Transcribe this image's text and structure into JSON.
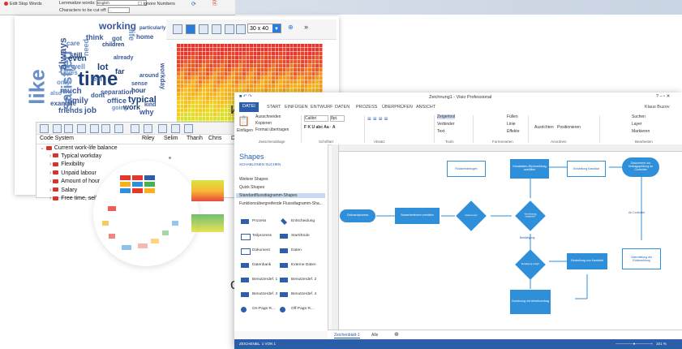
{
  "top_window": {
    "stop_words_label": "Edit Stop Words",
    "lemmatize_label": "Lemmatize words:",
    "language_value": "English",
    "chars_cut_label": "Characters to be cut off:",
    "chars_value": "...",
    "ignore_numbers_label": "Ignore Numbers"
  },
  "word_cloud": [
    {
      "w": "working",
      "c": "#3b5998"
    },
    {
      "w": "life",
      "c": "#6a8fc7"
    },
    {
      "w": "home",
      "c": "#3b5998"
    },
    {
      "w": "particularly",
      "c": "#3b5998"
    },
    {
      "w": "care",
      "c": "#5b7fb7"
    },
    {
      "w": "still",
      "c": "#1d3f7a"
    },
    {
      "w": "children",
      "c": "#1d3f7a"
    },
    {
      "w": "yes",
      "c": "#6a8fc7"
    },
    {
      "w": "already",
      "c": "#3b5998"
    },
    {
      "w": "lot",
      "c": "#1d3f7a"
    },
    {
      "w": "time",
      "c": "#1d3f7a"
    },
    {
      "w": "like",
      "c": "#6a8fc7"
    },
    {
      "w": "family",
      "c": "#3b5998"
    },
    {
      "w": "much",
      "c": "#3b5998"
    },
    {
      "w": "satisfied",
      "c": "#6a8fc7"
    },
    {
      "w": "always",
      "c": "#3b5998"
    },
    {
      "w": "even",
      "c": "#1d3f7a"
    },
    {
      "w": "well",
      "c": "#6a8fc7"
    },
    {
      "w": "separation",
      "c": "#3b5998"
    },
    {
      "w": "friends",
      "c": "#3b5998"
    },
    {
      "w": "office",
      "c": "#3b5998"
    },
    {
      "w": "typical",
      "c": "#1d3f7a"
    },
    {
      "w": "hour",
      "c": "#1d3f7a"
    },
    {
      "w": "example",
      "c": "#3b5998"
    },
    {
      "w": "sense",
      "c": "#3b5998"
    },
    {
      "w": "dont",
      "c": "#3b5998"
    },
    {
      "w": "job",
      "c": "#3b5998"
    },
    {
      "w": "need",
      "c": "#6a8fc7"
    },
    {
      "w": "feel",
      "c": "#3b5998"
    },
    {
      "w": "work",
      "c": "#1d3f7a"
    },
    {
      "w": "around",
      "c": "#3b5998"
    },
    {
      "w": "going",
      "c": "#6a8fc7"
    },
    {
      "w": "kind",
      "c": "#3b5998"
    },
    {
      "w": "workday",
      "c": "#3b5998"
    },
    {
      "w": "far",
      "c": "#1d3f7a"
    },
    {
      "w": "only",
      "c": "#6a8fc7"
    },
    {
      "w": "also",
      "c": "#6a8fc7"
    },
    {
      "w": "got",
      "c": "#3b5998"
    },
    {
      "w": "think",
      "c": "#3b5998"
    },
    {
      "w": "eyes",
      "c": "#6a8fc7"
    },
    {
      "w": "why",
      "c": "#3b5998"
    }
  ],
  "heatmap_toolbar": {
    "size_value": "30 x 40",
    "more": "»"
  },
  "heatmap_colors": [
    "#e7362c",
    "#e8452a",
    "#ea5a27",
    "#ef7a23",
    "#f49a1e",
    "#f7b21a",
    "#f6c11c",
    "#f2cf1f",
    "#e4dc2a",
    "#d6e12f"
  ],
  "code_system": {
    "header": [
      "Code System",
      "Riley",
      "Selim",
      "Thanh",
      "Chris",
      "D"
    ],
    "rows": [
      {
        "label": "Current work-life balance",
        "indent": 0
      },
      {
        "label": "Typical workday",
        "indent": 1
      },
      {
        "label": "Flexibility",
        "indent": 1
      },
      {
        "label": "Unpaid labour",
        "indent": 1
      },
      {
        "label": "Amount of hour",
        "indent": 1
      },
      {
        "label": "Salary",
        "indent": 1
      },
      {
        "label": "Free time, self",
        "indent": 1
      }
    ]
  },
  "partial_text": {
    "left_ni": "и",
    "left_ov": "ов"
  },
  "visio": {
    "title": "Zeichnung1 - Visio Professional",
    "user": "Klaus Buzov",
    "tabs": [
      "DATEI",
      "START",
      "EINFÜGEN",
      "ENTWURF",
      "DATEN",
      "PROZESS",
      "ÜBERPRÜFEN",
      "ANSICHT"
    ],
    "ribbon": {
      "paste": "Einfügen",
      "cut": "Ausschneiden",
      "copy": "Kopieren",
      "format": "Format übertragen",
      "font": "Calibri",
      "size": "8pt.",
      "pointer": "Zeigertool",
      "connector": "Verbinder",
      "text": "Text",
      "fill": "Füllen",
      "line": "Linie",
      "effects": "Effekte",
      "align": "Ausrichten",
      "position": "Positionieren",
      "find": "Suchen",
      "layer": "Layer",
      "select": "Markieren",
      "groups": [
        "Zwischenablage",
        "Schriftart",
        "Absatz",
        "Tools",
        "Formenarten",
        "Anordnen",
        "Bearbeiten"
      ]
    },
    "shapes_panel": {
      "title": "Shapes",
      "tabs": "SCHABLONEN   SUCHEN",
      "more": "Weitere Shapes",
      "quick": "Quick Shapes",
      "standard": "Standardflussdiagramm-Shapes",
      "functional": "Funktionsübergreifende Flussdiagramm-Sha...",
      "items": [
        [
          "Prozess",
          "Entscheidung"
        ],
        [
          "Teilprozess",
          "Start/Ende"
        ],
        [
          "Dokument",
          "Daten"
        ],
        [
          "Datenbank",
          "Externe Daten"
        ],
        [
          "Benutzerdef. 1",
          "Benutzerdef. 2"
        ],
        [
          "Benutzerdef. 3",
          "Benutzerdef. 4"
        ],
        [
          "On-Page R...",
          "Off-Page R..."
        ]
      ]
    },
    "flow": {
      "start": "Onboardprozess",
      "step1": "Bewerbertermin ermitteln",
      "dec1": "Zustimmung?",
      "dec2": "Vereinbarung erfolgreich?",
      "step2": "Kandidaten-Rückmeldung ausfüllen",
      "doc1": "Rückmeldebogen",
      "doc2": "Einstellung Kandidat",
      "step3": "Dokumente zur Vertragsprüfung an Controller",
      "dec3": "Bestätigung erfolgt?",
      "step4": "Einstellung von Kandidat",
      "doc3": "Übermittlung der Rückmeldung",
      "step5": "Zuordnung mit Arbeitsvertrag",
      "label_ja": "An Controller",
      "label_ok": "Bestätigung"
    },
    "sheet_tab": "Zeichenblatt-1",
    "sheet_all": "Alle",
    "status_left": "ZEICHENBL. 1 VON 1",
    "zoom": "101 %"
  }
}
